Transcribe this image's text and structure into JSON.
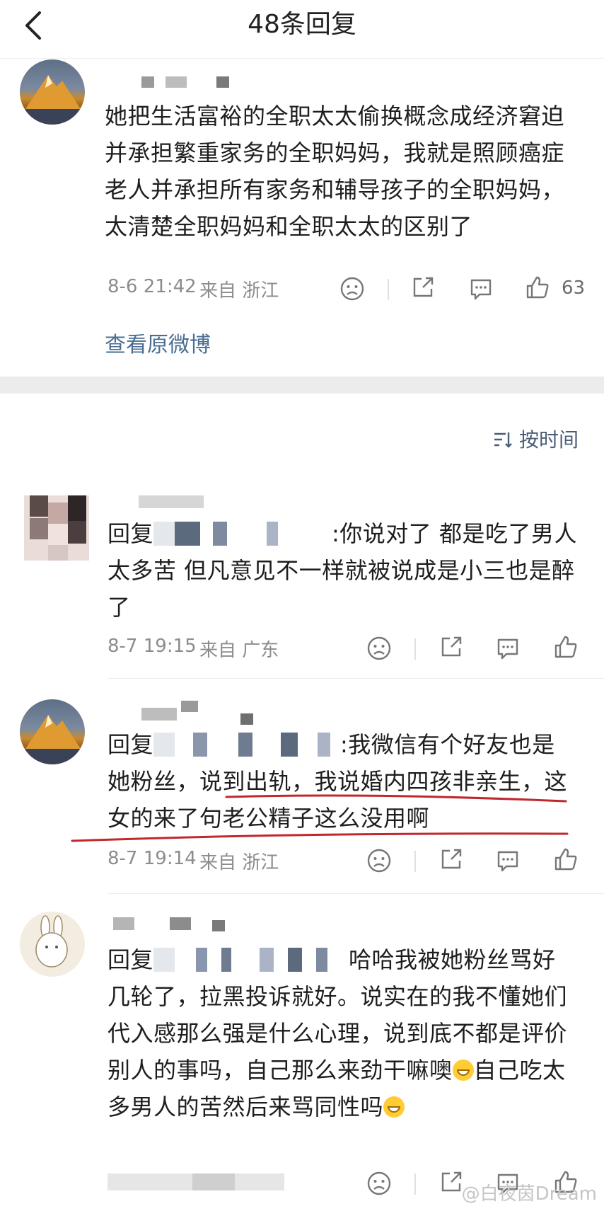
{
  "header": {
    "title": "48条回复"
  },
  "root_comment": {
    "text": "她把生活富裕的全职太太偷换概念成经济窘迫并承担繁重家务的全职妈妈，我就是照顾癌症老人并承担所有家务和辅导孩子的全职妈妈，太清楚全职妈妈和全职太太的区别了",
    "date": "8-6 21:42",
    "source": "来自 浙江",
    "like_count": "63",
    "view_original": "查看原微博"
  },
  "sort": {
    "label": "按时间"
  },
  "replies": [
    {
      "prefix": "回复",
      "text": ":你说对了 都是吃了男人太多苦 但凡意见不一样就被说成是小三也是醉了",
      "date": "8-7 19:15",
      "source": "来自 广东"
    },
    {
      "prefix": "回复",
      "text_plain": ":我微信有个好友也是她粉丝，",
      "text_underlined": "说到出轨，我说婚内四孩非亲生，这女的来了句老公精子这么没用啊",
      "date": "8-7 19:14",
      "source": "来自 浙江"
    },
    {
      "prefix": "回复",
      "text_part1": "哈哈我被她粉丝骂好几轮了，拉黑投诉就好。说实在的我不懂她们代入感那么强是什么心理，说到底不都是评价别人的事吗，自己那么来劲干嘛噢",
      "text_part2": "自己吃太多男人的苦然后来骂同性吗",
      "emoji": "grin-emoji"
    }
  ],
  "watermark": "@白夜茵Dream",
  "colors": {
    "link": "#4a6e92",
    "underline": "#c0282d",
    "band": "#ececec"
  }
}
